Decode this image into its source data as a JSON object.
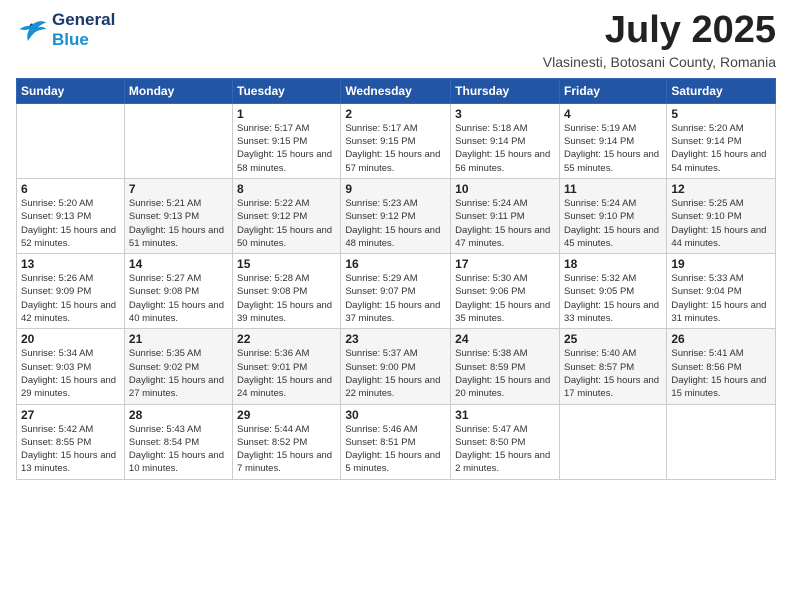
{
  "header": {
    "logo_line1": "General",
    "logo_line2": "Blue",
    "month": "July 2025",
    "location": "Vlasinesti, Botosani County, Romania"
  },
  "weekdays": [
    "Sunday",
    "Monday",
    "Tuesday",
    "Wednesday",
    "Thursday",
    "Friday",
    "Saturday"
  ],
  "weeks": [
    [
      {
        "day": "",
        "sunrise": "",
        "sunset": "",
        "daylight": ""
      },
      {
        "day": "",
        "sunrise": "",
        "sunset": "",
        "daylight": ""
      },
      {
        "day": "1",
        "sunrise": "Sunrise: 5:17 AM",
        "sunset": "Sunset: 9:15 PM",
        "daylight": "Daylight: 15 hours and 58 minutes."
      },
      {
        "day": "2",
        "sunrise": "Sunrise: 5:17 AM",
        "sunset": "Sunset: 9:15 PM",
        "daylight": "Daylight: 15 hours and 57 minutes."
      },
      {
        "day": "3",
        "sunrise": "Sunrise: 5:18 AM",
        "sunset": "Sunset: 9:14 PM",
        "daylight": "Daylight: 15 hours and 56 minutes."
      },
      {
        "day": "4",
        "sunrise": "Sunrise: 5:19 AM",
        "sunset": "Sunset: 9:14 PM",
        "daylight": "Daylight: 15 hours and 55 minutes."
      },
      {
        "day": "5",
        "sunrise": "Sunrise: 5:20 AM",
        "sunset": "Sunset: 9:14 PM",
        "daylight": "Daylight: 15 hours and 54 minutes."
      }
    ],
    [
      {
        "day": "6",
        "sunrise": "Sunrise: 5:20 AM",
        "sunset": "Sunset: 9:13 PM",
        "daylight": "Daylight: 15 hours and 52 minutes."
      },
      {
        "day": "7",
        "sunrise": "Sunrise: 5:21 AM",
        "sunset": "Sunset: 9:13 PM",
        "daylight": "Daylight: 15 hours and 51 minutes."
      },
      {
        "day": "8",
        "sunrise": "Sunrise: 5:22 AM",
        "sunset": "Sunset: 9:12 PM",
        "daylight": "Daylight: 15 hours and 50 minutes."
      },
      {
        "day": "9",
        "sunrise": "Sunrise: 5:23 AM",
        "sunset": "Sunset: 9:12 PM",
        "daylight": "Daylight: 15 hours and 48 minutes."
      },
      {
        "day": "10",
        "sunrise": "Sunrise: 5:24 AM",
        "sunset": "Sunset: 9:11 PM",
        "daylight": "Daylight: 15 hours and 47 minutes."
      },
      {
        "day": "11",
        "sunrise": "Sunrise: 5:24 AM",
        "sunset": "Sunset: 9:10 PM",
        "daylight": "Daylight: 15 hours and 45 minutes."
      },
      {
        "day": "12",
        "sunrise": "Sunrise: 5:25 AM",
        "sunset": "Sunset: 9:10 PM",
        "daylight": "Daylight: 15 hours and 44 minutes."
      }
    ],
    [
      {
        "day": "13",
        "sunrise": "Sunrise: 5:26 AM",
        "sunset": "Sunset: 9:09 PM",
        "daylight": "Daylight: 15 hours and 42 minutes."
      },
      {
        "day": "14",
        "sunrise": "Sunrise: 5:27 AM",
        "sunset": "Sunset: 9:08 PM",
        "daylight": "Daylight: 15 hours and 40 minutes."
      },
      {
        "day": "15",
        "sunrise": "Sunrise: 5:28 AM",
        "sunset": "Sunset: 9:08 PM",
        "daylight": "Daylight: 15 hours and 39 minutes."
      },
      {
        "day": "16",
        "sunrise": "Sunrise: 5:29 AM",
        "sunset": "Sunset: 9:07 PM",
        "daylight": "Daylight: 15 hours and 37 minutes."
      },
      {
        "day": "17",
        "sunrise": "Sunrise: 5:30 AM",
        "sunset": "Sunset: 9:06 PM",
        "daylight": "Daylight: 15 hours and 35 minutes."
      },
      {
        "day": "18",
        "sunrise": "Sunrise: 5:32 AM",
        "sunset": "Sunset: 9:05 PM",
        "daylight": "Daylight: 15 hours and 33 minutes."
      },
      {
        "day": "19",
        "sunrise": "Sunrise: 5:33 AM",
        "sunset": "Sunset: 9:04 PM",
        "daylight": "Daylight: 15 hours and 31 minutes."
      }
    ],
    [
      {
        "day": "20",
        "sunrise": "Sunrise: 5:34 AM",
        "sunset": "Sunset: 9:03 PM",
        "daylight": "Daylight: 15 hours and 29 minutes."
      },
      {
        "day": "21",
        "sunrise": "Sunrise: 5:35 AM",
        "sunset": "Sunset: 9:02 PM",
        "daylight": "Daylight: 15 hours and 27 minutes."
      },
      {
        "day": "22",
        "sunrise": "Sunrise: 5:36 AM",
        "sunset": "Sunset: 9:01 PM",
        "daylight": "Daylight: 15 hours and 24 minutes."
      },
      {
        "day": "23",
        "sunrise": "Sunrise: 5:37 AM",
        "sunset": "Sunset: 9:00 PM",
        "daylight": "Daylight: 15 hours and 22 minutes."
      },
      {
        "day": "24",
        "sunrise": "Sunrise: 5:38 AM",
        "sunset": "Sunset: 8:59 PM",
        "daylight": "Daylight: 15 hours and 20 minutes."
      },
      {
        "day": "25",
        "sunrise": "Sunrise: 5:40 AM",
        "sunset": "Sunset: 8:57 PM",
        "daylight": "Daylight: 15 hours and 17 minutes."
      },
      {
        "day": "26",
        "sunrise": "Sunrise: 5:41 AM",
        "sunset": "Sunset: 8:56 PM",
        "daylight": "Daylight: 15 hours and 15 minutes."
      }
    ],
    [
      {
        "day": "27",
        "sunrise": "Sunrise: 5:42 AM",
        "sunset": "Sunset: 8:55 PM",
        "daylight": "Daylight: 15 hours and 13 minutes."
      },
      {
        "day": "28",
        "sunrise": "Sunrise: 5:43 AM",
        "sunset": "Sunset: 8:54 PM",
        "daylight": "Daylight: 15 hours and 10 minutes."
      },
      {
        "day": "29",
        "sunrise": "Sunrise: 5:44 AM",
        "sunset": "Sunset: 8:52 PM",
        "daylight": "Daylight: 15 hours and 7 minutes."
      },
      {
        "day": "30",
        "sunrise": "Sunrise: 5:46 AM",
        "sunset": "Sunset: 8:51 PM",
        "daylight": "Daylight: 15 hours and 5 minutes."
      },
      {
        "day": "31",
        "sunrise": "Sunrise: 5:47 AM",
        "sunset": "Sunset: 8:50 PM",
        "daylight": "Daylight: 15 hours and 2 minutes."
      },
      {
        "day": "",
        "sunrise": "",
        "sunset": "",
        "daylight": ""
      },
      {
        "day": "",
        "sunrise": "",
        "sunset": "",
        "daylight": ""
      }
    ]
  ]
}
